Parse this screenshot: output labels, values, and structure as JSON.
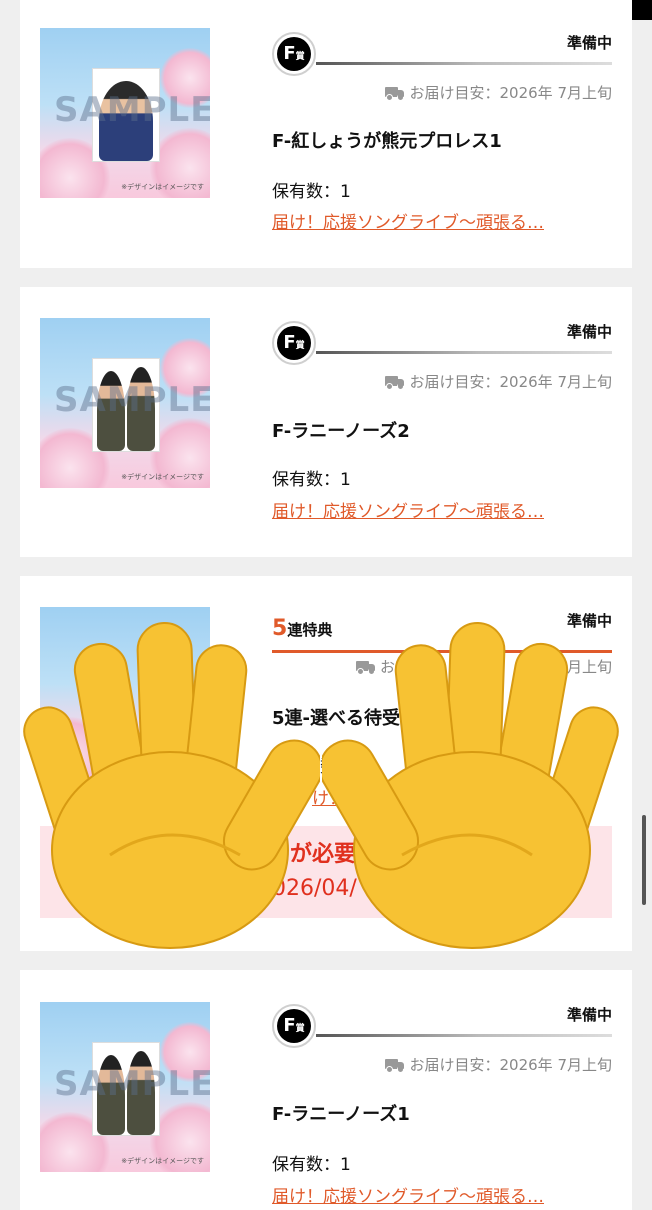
{
  "items": [
    {
      "status": "準備中",
      "badge_letter": "F",
      "badge_suffix": "賞",
      "delivery_label": "お届け目安：",
      "delivery_value": "2026年 7月上旬",
      "title": "F-紅しょうが熊元プロレス1",
      "qty_label": "保有数：",
      "qty_value": "1",
      "link": "届け！応援ソングライブ〜頑張る…",
      "sample": "SAMPLE",
      "note": "※デザインはイメージです"
    },
    {
      "status": "準備中",
      "badge_letter": "F",
      "badge_suffix": "賞",
      "delivery_label": "お届け目安：",
      "delivery_value": "2026年 7月上旬",
      "title": "F-ラニーノーズ2",
      "qty_label": "保有数：",
      "qty_value": "1",
      "link": "届け！応援ソングライブ〜頑張る…",
      "sample": "SAMPLE",
      "note": "※デザインはイメージです"
    },
    {
      "status": "準備中",
      "bonus_num": "5",
      "bonus_label": "連特典",
      "delivery_label": "お届け目",
      "delivery_value": "7月上旬",
      "title": "5連-選べる待受画",
      "qty_label": "数",
      "link": "け！応",
      "notice_line1": "が必要",
      "notice_line2": "026/04/"
    },
    {
      "status": "準備中",
      "badge_letter": "F",
      "badge_suffix": "賞",
      "delivery_label": "お届け目安：",
      "delivery_value": "2026年 7月上旬",
      "title": "F-ラニーノーズ1",
      "qty_label": "保有数：",
      "qty_value": "1",
      "link": "届け！応援ソングライブ〜頑張る…",
      "sample": "SAMPLE",
      "note": "※デザインはイメージです"
    }
  ],
  "overlay": {
    "icon": "raised-hands-emoji",
    "color": "#f7c233"
  }
}
